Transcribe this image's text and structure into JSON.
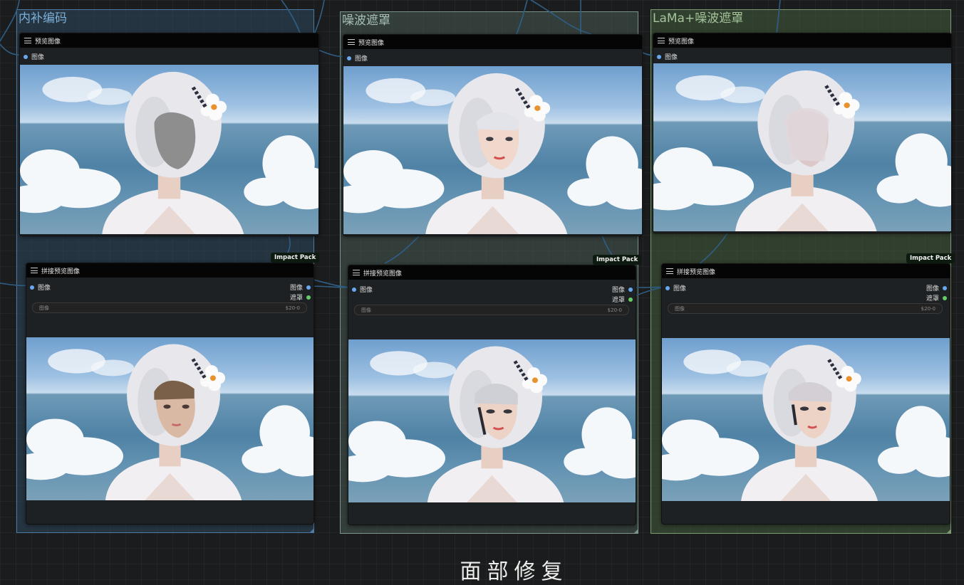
{
  "groups": [
    {
      "title": "内补编码",
      "color": "#4c7aa3"
    },
    {
      "title": "噪波遮罩",
      "color": "#7a948a"
    },
    {
      "title": "LaMa+噪波遮罩",
      "color": "#7b9a72"
    }
  ],
  "preview_node": {
    "title": "预览图像",
    "input_label": "图像"
  },
  "stitch_node": {
    "title": "拼接预览图像",
    "input_label": "图像",
    "output_image_label": "图像",
    "output_mask_label": "遮罩",
    "widget_name": "图像",
    "widget_value": "$20-0"
  },
  "badge_label": "Impact Pack",
  "footer_title": "面部修复",
  "colors": {
    "canvas_bg": "#1b1c1d",
    "node_bg": "#1e2123",
    "node_title_bg": "#050505",
    "image_socket": "#68a8f0",
    "mask_socket": "#66cc66",
    "wire": "#2f5f86"
  },
  "icons": {
    "node_menu": "menu-icon",
    "input_socket": "socket-dot",
    "output_socket": "socket-dot"
  }
}
